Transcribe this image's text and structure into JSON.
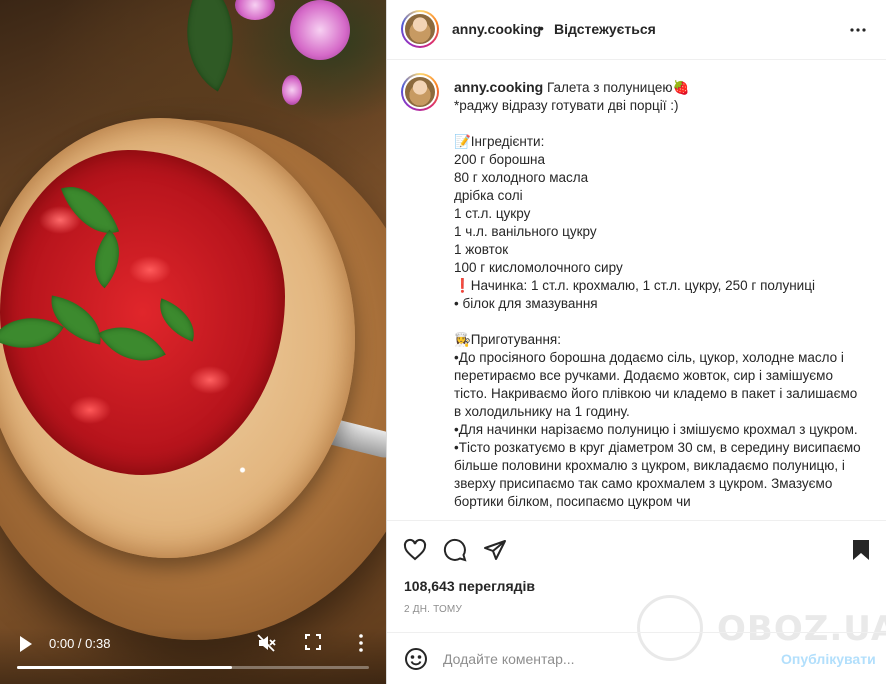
{
  "video": {
    "time": "0:00 / 0:38",
    "progress": 0.61
  },
  "header": {
    "username": "anny.cooking",
    "separator": "•",
    "follow_status": "Відстежується"
  },
  "caption": {
    "username": "anny.cooking",
    "lines": [
      "Галета з полуницею🍓",
      "*раджу відразу готувати дві порції :)",
      "",
      "📝Інгредієнти:",
      "200 г борошна",
      "80 г холодного масла",
      "дрібка солі",
      "1 ст.л. цукру",
      "1 ч.л. ванільного цукру",
      "1 жовток",
      "100 г кисломолочного сиру",
      "❗️Начинка: 1 ст.л. крохмалю, 1 ст.л. цукру, 250 г полуниці",
      "• білок для змазування",
      "",
      "👩‍🍳Приготування:",
      "•До просіяного борошна додаємо сіль, цукор, холодне масло і перетираємо все ручками. Додаємо жовток, сир і замішуємо тісто. Накриваємо його плівкою чи кладемо в пакет і залишаємо в холодильнику на 1 годину.",
      "•Для начинки нарізаємо полуницю і змішуємо крохмал з цукром.",
      "•Тісто розкатуємо в круг діаметром 30 см, в середину висипаємо більше половини крохмалю з цукром, викладаємо полуницю, і зверху присипаємо так само крохмалем з цукром. Змазуємо бортики білком, посипаємо цукром чи"
    ]
  },
  "stats": {
    "views": "108,643 переглядів",
    "date": "2 ДН. ТОМУ"
  },
  "comment": {
    "placeholder": "Додайте коментар...",
    "post_label": "Опублікувати"
  },
  "watermark": {
    "text": "OBOZ.UA"
  },
  "colors": {
    "link_disabled": "#b2dffc",
    "text": "#262626",
    "muted": "#8e8e8e"
  }
}
